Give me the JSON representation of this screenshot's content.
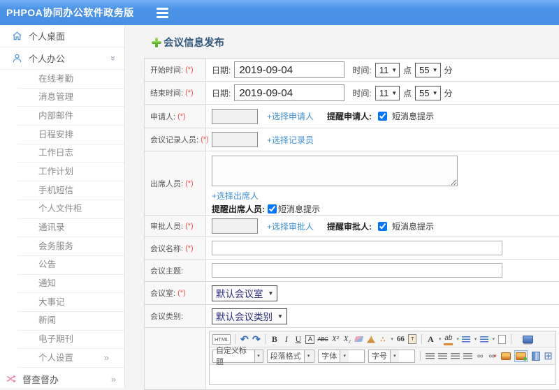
{
  "topbar": {
    "title": "PHPOA协同办公软件政务版"
  },
  "icons": {
    "chevron_double": "»",
    "caret_down": "▼",
    "caret_tiny": "▾"
  },
  "sidebar": {
    "desktop": "个人桌面",
    "office": "个人办公",
    "submenu": [
      "在线考勤",
      "消息管理",
      "内部邮件",
      "日程安排",
      "工作日志",
      "工作计划",
      "手机短信",
      "个人文件柜",
      "通讯录",
      "会务服务",
      "公告",
      "通知",
      "大事记",
      "新闻",
      "电子期刊"
    ],
    "settings": "个人设置",
    "supervise": "督查督办"
  },
  "page": {
    "title": "会议信息发布"
  },
  "form": {
    "start_time": {
      "label": "开始时间:",
      "required": "(*)",
      "date_label": "日期:",
      "date_value": "2019-09-04",
      "time_label": "时间:",
      "hour": "11",
      "hour_unit": "点",
      "minute": "55",
      "minute_unit": "分"
    },
    "end_time": {
      "label": "结束时间:",
      "required": "(*)",
      "date_label": "日期:",
      "date_value": "2019-09-04",
      "time_label": "时间:",
      "hour": "11",
      "hour_unit": "点",
      "minute": "55",
      "minute_unit": "分"
    },
    "applicant": {
      "label": "申请人:",
      "required": "(*)",
      "value": "",
      "link": "+选择申请人",
      "remind_label": "提醒申请人:",
      "sms_label": "短消息提示",
      "checked": true
    },
    "recorder": {
      "label": "会议记录人员:",
      "required": "(*)",
      "value": "",
      "link": "+选择记录员"
    },
    "attendees": {
      "label": "出席人员:",
      "required": "(*)",
      "value": "",
      "link": "+选择出席人",
      "remind_label": "提醒出席人员:",
      "sms_label": "短消息提示",
      "checked": true
    },
    "approver": {
      "label": "审批人员:",
      "required": "(*)",
      "value": "",
      "link": "+选择审批人",
      "remind_label": "提醒审批人:",
      "sms_label": "短消息提示",
      "checked": true
    },
    "meeting_name": {
      "label": "会议名称:",
      "required": "(*)",
      "value": ""
    },
    "meeting_subject": {
      "label": "会议主题:",
      "value": ""
    },
    "meeting_room": {
      "label": "会议室:",
      "required": "(*)",
      "selected": "默认会议室"
    },
    "meeting_category": {
      "label": "会议类别:",
      "selected": "默认会议类别"
    }
  },
  "editor": {
    "icons": {
      "html": "HTML",
      "undo": "↶",
      "redo": "↷",
      "bold": "B",
      "italic": "I",
      "underline": "U",
      "border_a": "A",
      "strike": "ABC",
      "superscript": "X²",
      "subscript": "X₂",
      "wand": "∴",
      "quote": "66",
      "paste": "T",
      "font_color": "A",
      "highlight": "ab",
      "link": "∞",
      "unlink": "∞",
      "unlink_x": "×",
      "table": "⊞"
    },
    "selects": {
      "heading": "自定义标题",
      "paragraph": "段落格式",
      "font": "字体",
      "size": "字号"
    }
  },
  "colors": {
    "topbar": "#4a93e7",
    "accent": "#4a90e2",
    "link": "#3f90d8",
    "required": "#f25555",
    "supervise_icon": "#ef87a5"
  }
}
